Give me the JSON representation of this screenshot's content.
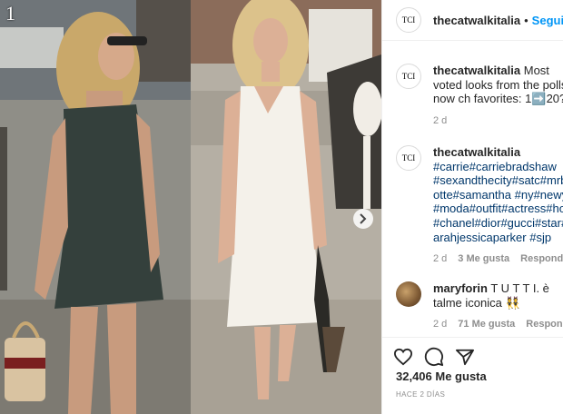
{
  "post": {
    "carousel_index": "1",
    "account": {
      "avatar_text": "TCI",
      "username": "thecatwalkitalia",
      "follow_label": "Seguir"
    },
    "caption": {
      "username": "thecatwalkitalia",
      "text": "Most voted looks from the polls, now ch favorites: 1➡️20?",
      "time": "2 d"
    },
    "hashtag_comment": {
      "username": "thecatwalkitalia",
      "text": "#carrie#carriebradshaw #sexandthecity#satc#mrbig otte#samantha #ny#newyor #moda#outfit#actress#holly #chanel#dior#gucci#star#ce arahjessicaparker #sjp",
      "time": "2 d",
      "likes": "3 Me gusta",
      "reply": "Responder"
    },
    "user_comment": {
      "username": "maryforin",
      "text": "T U T T I. è talme iconica 👯",
      "time": "2 d",
      "likes": "71 Me gusta",
      "reply": "Responder"
    },
    "likes_count": "32,406",
    "likes_label": "Me gusta",
    "timestamp": "HACE 2 DÍAS"
  },
  "icons": [
    "heart-icon",
    "comment-icon",
    "share-icon",
    "chevron-right-icon"
  ],
  "colors": {
    "link": "#0095f6",
    "hashtag": "#00376b",
    "meta": "#8e8e8e"
  }
}
